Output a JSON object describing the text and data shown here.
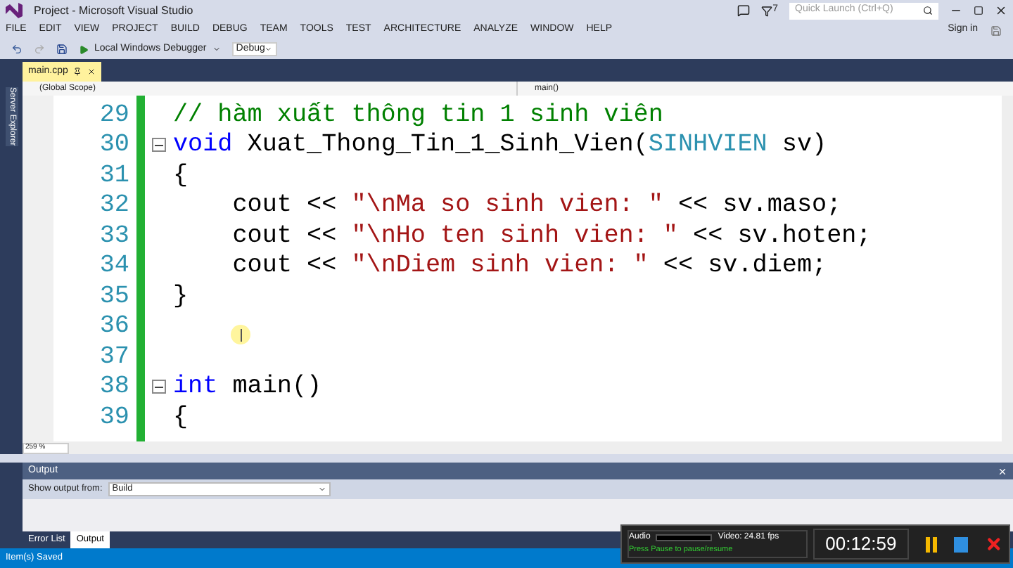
{
  "window": {
    "title": "Project - Microsoft Visual Studio",
    "quick_launch": {
      "placeholder": "Quick Launch (Ctrl+Q)"
    },
    "notification_count": "7"
  },
  "menu": [
    "FILE",
    "EDIT",
    "VIEW",
    "PROJECT",
    "BUILD",
    "DEBUG",
    "TEAM",
    "TOOLS",
    "TEST",
    "ARCHITECTURE",
    "ANALYZE",
    "WINDOW",
    "HELP"
  ],
  "sign_in": "Sign in",
  "toolbar": {
    "debugger": "Local Windows Debugger",
    "configuration": "Debug"
  },
  "tabs": [
    {
      "label": "main.cpp",
      "selected": true
    }
  ],
  "side_panel": "Server Explorer",
  "navigation": {
    "scope": "(Global Scope)",
    "member": "main()"
  },
  "editor": {
    "zoom": "259 %",
    "lines": [
      {
        "number": "29",
        "fold_start": false,
        "segments": [
          {
            "kind": "comment",
            "text": "// hàm xuất thông tin 1 sinh viên"
          }
        ]
      },
      {
        "number": "30",
        "fold_start": true,
        "segments": [
          {
            "kind": "keyword",
            "text": "void"
          },
          {
            "kind": "plain",
            "text": " Xuat_Thong_Tin_1_Sinh_Vien("
          },
          {
            "kind": "type",
            "text": "SINHVIEN"
          },
          {
            "kind": "plain",
            "text": " sv)"
          }
        ]
      },
      {
        "number": "31",
        "fold_start": false,
        "segments": [
          {
            "kind": "plain",
            "text": "{"
          }
        ]
      },
      {
        "number": "32",
        "fold_start": false,
        "segments": [
          {
            "kind": "plain",
            "text": "    cout << "
          },
          {
            "kind": "string",
            "text": "\"\\nMa so sinh vien: \""
          },
          {
            "kind": "plain",
            "text": " << sv.maso;"
          }
        ]
      },
      {
        "number": "33",
        "fold_start": false,
        "segments": [
          {
            "kind": "plain",
            "text": "    cout << "
          },
          {
            "kind": "string",
            "text": "\"\\nHo ten sinh vien: \""
          },
          {
            "kind": "plain",
            "text": " << sv.hoten;"
          }
        ]
      },
      {
        "number": "34",
        "fold_start": false,
        "segments": [
          {
            "kind": "plain",
            "text": "    cout << "
          },
          {
            "kind": "string",
            "text": "\"\\nDiem sinh vien: \""
          },
          {
            "kind": "plain",
            "text": " << sv.diem;"
          }
        ]
      },
      {
        "number": "35",
        "fold_start": false,
        "segments": [
          {
            "kind": "plain",
            "text": "}"
          }
        ]
      },
      {
        "number": "36",
        "fold_start": false
      },
      {
        "number": "37",
        "fold_start": false
      },
      {
        "number": "38",
        "fold_start": true,
        "segments": [
          {
            "kind": "keyword",
            "text": "int"
          },
          {
            "kind": "plain",
            "text": " main()"
          }
        ]
      },
      {
        "number": "39",
        "fold_start": false,
        "segments": [
          {
            "kind": "plain",
            "text": "{"
          }
        ]
      }
    ]
  },
  "output": {
    "title": "Output",
    "source_label": "Show output from:",
    "source": "Build"
  },
  "bottom_tabs": [
    {
      "label": "Error List",
      "selected": false
    },
    {
      "label": "Output",
      "selected": true
    }
  ],
  "status_bar": "Item(s) Saved",
  "recorder": {
    "audio_label": "Audio",
    "video": "Video: 24.81 fps",
    "hint": "Press Pause to pause/resume",
    "time": "00:12:59"
  }
}
